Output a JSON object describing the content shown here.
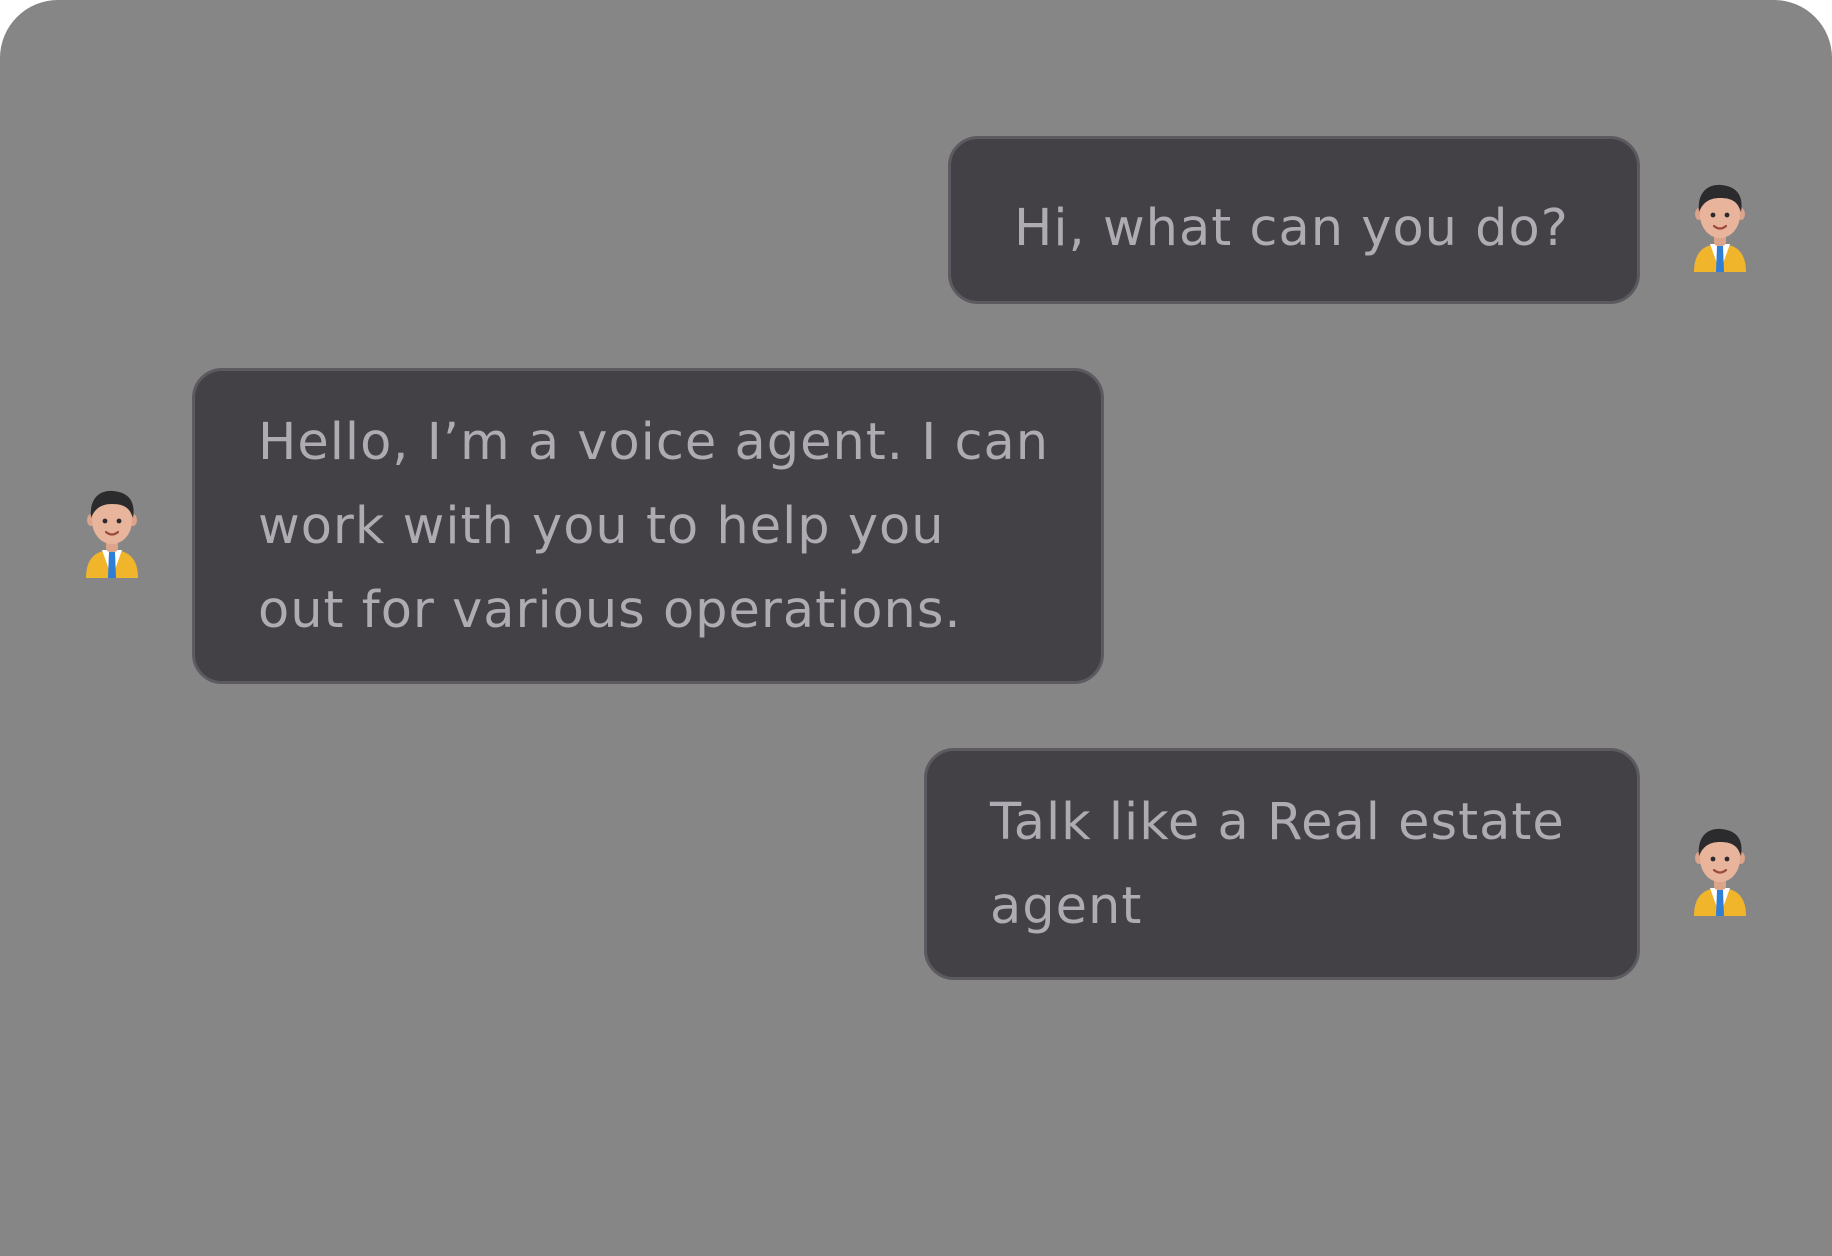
{
  "chat": {
    "messages": [
      {
        "sender": "user",
        "lines": [
          "Hi, what can you do?"
        ]
      },
      {
        "sender": "agent",
        "lines": [
          "Hello, I’m a voice agent. I can",
          "work with you to help you",
          "out for various operations."
        ]
      },
      {
        "sender": "user",
        "lines": [
          "Talk like a Real estate",
          "agent"
        ]
      }
    ],
    "avatar_icon": "person-avatar-icon"
  },
  "colors": {
    "background": "#868686",
    "bubble": "#434146",
    "bubble_border": "#5c5a60",
    "text": "#aeacb2",
    "jacket": "#f0b52b",
    "tie": "#2f7fd8"
  }
}
